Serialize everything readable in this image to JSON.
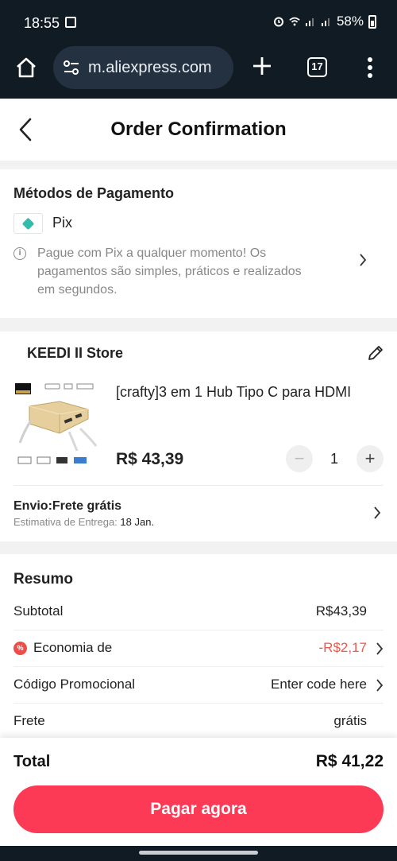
{
  "status_bar": {
    "time": "18:55",
    "battery": "58%"
  },
  "browser": {
    "url": "m.aliexpress.com",
    "tab_count": "17"
  },
  "header": {
    "title": "Order Confirmation"
  },
  "payment": {
    "section_title": "Métodos de Pagamento",
    "method": "Pix",
    "info": "Pague com Pix a qualquer momento! Os pagamentos são simples, práticos e realizados em segundos."
  },
  "store": {
    "name": "KEEDI II Store",
    "product_title": "[crafty]3 em 1 Hub Tipo C para HDMI",
    "price": "R$ 43,39",
    "quantity": "1",
    "shipping_title": "Envio:Frete grátis",
    "delivery_label": "Estimativa de Entrega:",
    "delivery_date": "18 Jan."
  },
  "summary": {
    "title": "Resumo",
    "rows": [
      {
        "label": "Subtotal",
        "value": "R$43,39"
      },
      {
        "label": "Economia de",
        "value": "-R$2,17"
      },
      {
        "label": "Código Promocional",
        "value": "Enter code here"
      },
      {
        "label": "Frete",
        "value": "grátis"
      }
    ]
  },
  "footer": {
    "total_label": "Total",
    "total_value": "R$ 41,22",
    "pay_button": "Pagar agora"
  },
  "colors": {
    "accent": "#fd3a55",
    "discount": "#f0574b",
    "pix": "#32bcad",
    "browser_bg": "#111b24"
  },
  "icons": [
    "home-icon",
    "tune-icon",
    "plus-icon",
    "tabs-icon",
    "more-icon",
    "back-icon",
    "pix-icon",
    "info-icon",
    "chevron-right-icon",
    "edit-icon",
    "minus-icon",
    "discount-icon"
  ]
}
